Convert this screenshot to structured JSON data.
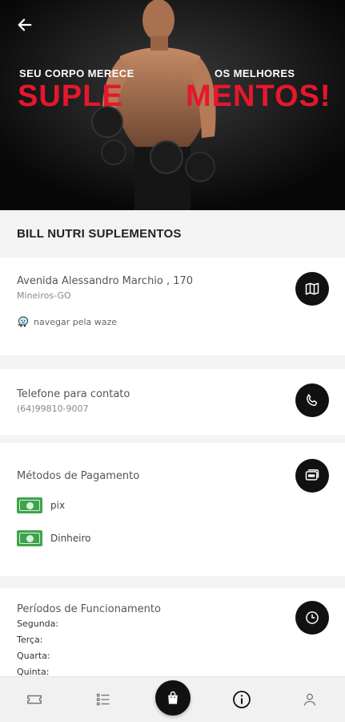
{
  "hero": {
    "line1_left": "SEU CORPO MERECE",
    "line1_right": "OS MELHORES",
    "big_left": "SUPLE",
    "big_right": "MENTOS!"
  },
  "store": {
    "name": "BILL NUTRI SUPLEMENTOS"
  },
  "address": {
    "street": "Avenida Alessandro Marchio , 170",
    "city": "Mineiros-GO",
    "waze_label": "navegar pela waze"
  },
  "phone": {
    "label": "Telefone para contato",
    "number": "(64)99810-9007"
  },
  "payment": {
    "label": "Métodos de Pagamento",
    "methods": [
      "pix",
      "Dinheiro"
    ]
  },
  "hours": {
    "label": "Períodos de Funcionamento",
    "days": [
      "Segunda:",
      "Terça:",
      "Quarta:",
      "Quinta:"
    ]
  },
  "colors": {
    "accent": "#e6172c",
    "dark": "#111111",
    "cash_green": "#3fa34d"
  },
  "icons": {
    "back": "arrow-left-icon",
    "map": "map-icon",
    "phone": "phone-icon",
    "payment": "wallet-icon",
    "clock": "clock-icon",
    "waze": "waze-icon",
    "nav": [
      "ticket-icon",
      "list-icon",
      "shopping-bag-icon",
      "info-icon",
      "user-icon"
    ]
  }
}
